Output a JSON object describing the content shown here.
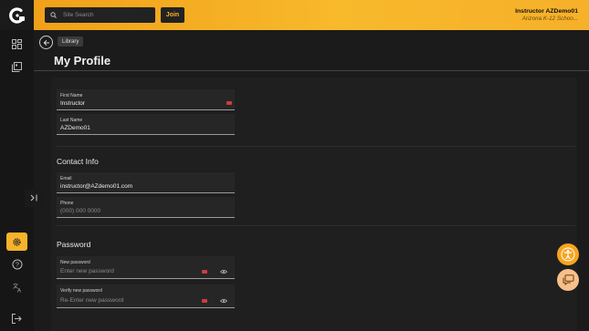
{
  "header": {
    "search_placeholder": "Site Search",
    "join_label": "Join",
    "user_name": "Instructor AZDemo01",
    "user_org": "Arizona K-12 Schoo..."
  },
  "nav": {
    "back_crumb": "Library"
  },
  "page": {
    "title": "My Profile"
  },
  "profile": {
    "first_name": {
      "label": "First Name",
      "value": "Instructor"
    },
    "last_name": {
      "label": "Last Name",
      "value": "AZDemo01"
    }
  },
  "contact": {
    "heading": "Contact Info",
    "email": {
      "label": "Email",
      "value": "instructor@AZdemo01.com"
    },
    "phone": {
      "label": "Phone",
      "placeholder": "(000) 000 0000"
    }
  },
  "password": {
    "heading": "Password",
    "new": {
      "label": "New password",
      "placeholder": "Enter new password"
    },
    "verify": {
      "label": "Verify new password",
      "placeholder": "Re-Enter new password"
    }
  },
  "colors": {
    "accent": "#f6b22a",
    "header_start": "#f1a019",
    "background": "#1b1b1b"
  }
}
